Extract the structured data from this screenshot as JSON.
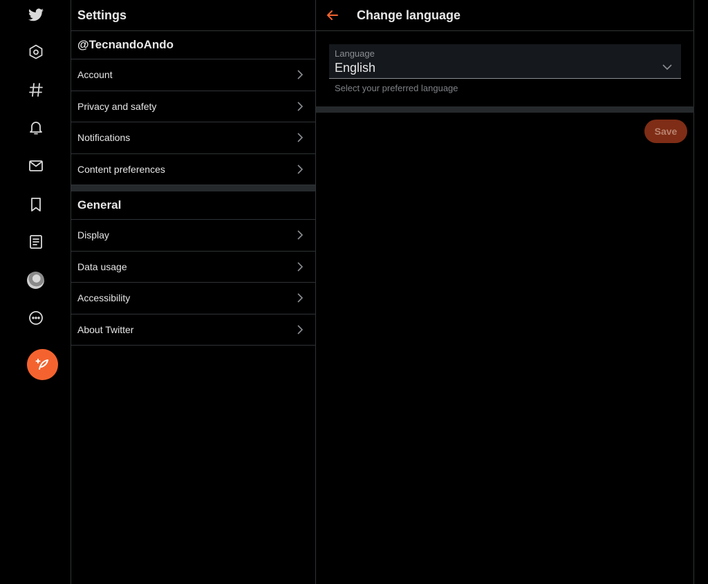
{
  "rail": {
    "icons": [
      "twitter-logo-icon",
      "home-icon",
      "hashtag-icon",
      "bell-icon",
      "mail-icon",
      "bookmark-icon",
      "list-icon",
      "avatar",
      "more-icon",
      "compose-icon"
    ],
    "accent": "#f4632f"
  },
  "settings": {
    "title": "Settings",
    "account_section": {
      "handle": "@TecnandoAndo",
      "items": [
        {
          "label": "Account"
        },
        {
          "label": "Privacy and safety"
        },
        {
          "label": "Notifications"
        },
        {
          "label": "Content preferences"
        }
      ]
    },
    "general_section": {
      "title": "General",
      "items": [
        {
          "label": "Display"
        },
        {
          "label": "Data usage"
        },
        {
          "label": "Accessibility"
        },
        {
          "label": "About Twitter"
        }
      ]
    }
  },
  "main": {
    "title": "Change language",
    "language_field": {
      "label": "Language",
      "value": "English",
      "help": "Select your preferred language"
    },
    "save_label": "Save"
  }
}
